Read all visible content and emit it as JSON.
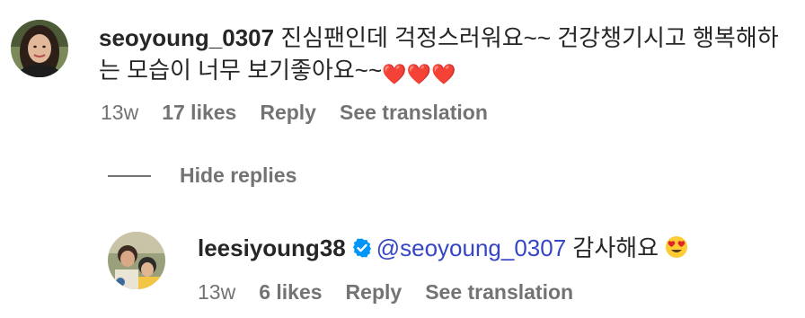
{
  "comments": [
    {
      "username": "seoyoung_0307",
      "text": "진심팬인데 걱정스러워요~~ 건강챙기시고 행복해하는 모습이 너무 보기좋아요~~",
      "emoji": "❤️❤️❤️",
      "time": "13w",
      "likes": "17 likes",
      "reply_label": "Reply",
      "translate_label": "See translation"
    }
  ],
  "toggle_replies": {
    "label": "Hide replies"
  },
  "replies": [
    {
      "username": "leesiyoung38",
      "verified": true,
      "mention": "@seoyoung_0307",
      "text": "감사해요",
      "emoji": "heart-eyes-emoji",
      "time": "13w",
      "likes": "6 likes",
      "reply_label": "Reply",
      "translate_label": "See translation"
    }
  ],
  "colors": {
    "text": "#262626",
    "meta": "#737373",
    "mention": "#3546c5",
    "verified": "#0095f6",
    "heart": "#e0242b"
  }
}
